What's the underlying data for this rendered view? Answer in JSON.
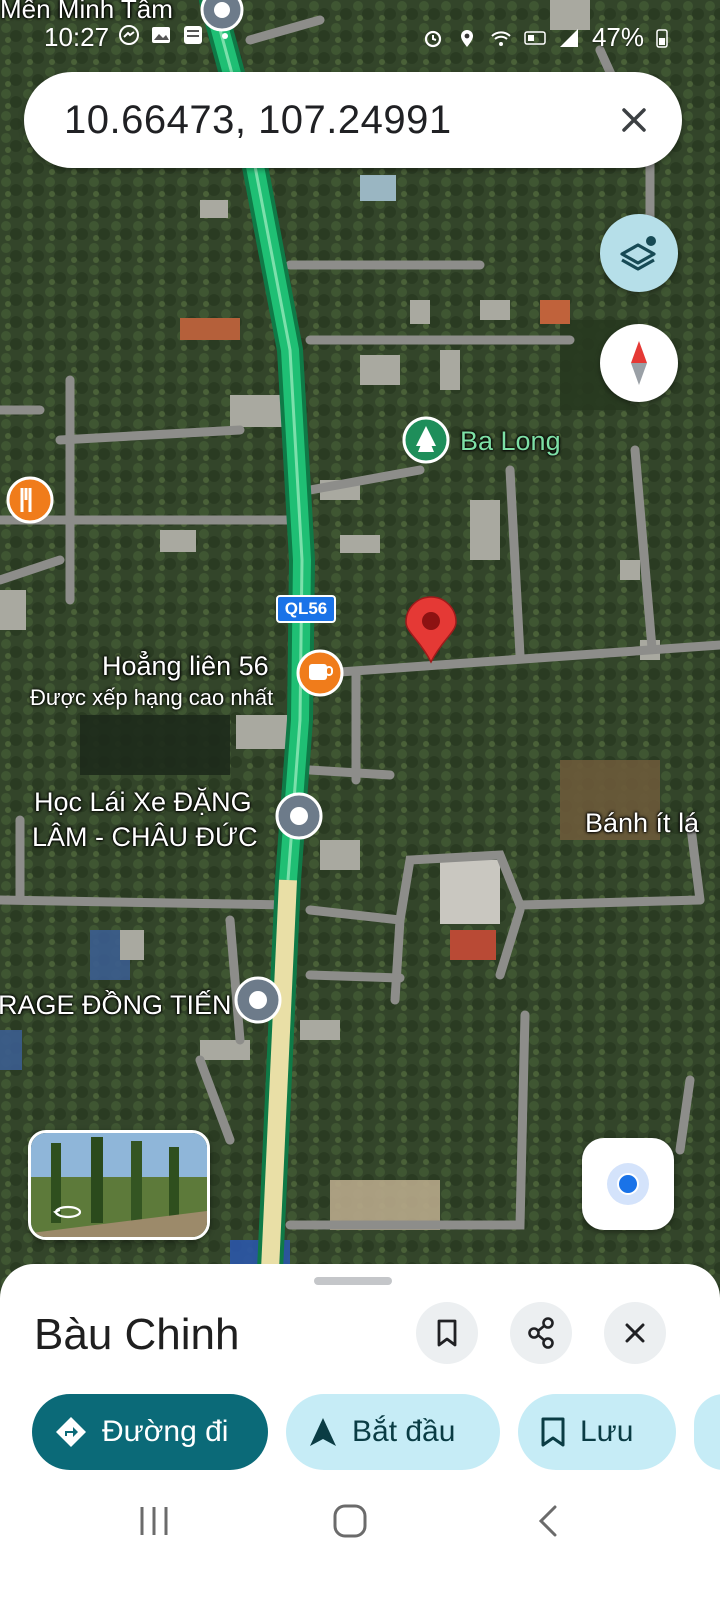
{
  "status_bar": {
    "time": "10:27",
    "battery": "47%",
    "left_icons": [
      "messenger-icon",
      "gallery-icon",
      "baomoi-icon",
      "dot-icon"
    ],
    "right_icons": [
      "alarm-icon",
      "location-icon",
      "wifi-icon",
      "volte-icon",
      "signal-icon",
      "battery-icon"
    ]
  },
  "search": {
    "query": "10.66473, 107.24991"
  },
  "map": {
    "partial_top_label": "Mến Minh Tâm",
    "route_shield": "QL56",
    "pois": {
      "ba_long": "Ba Long",
      "hoang_lien": "Hoẳng liên 56",
      "hoang_lien_sub": "Được xếp hạng cao nhất",
      "hoc_lai_xe_line1": "Học Lái Xe ĐẶNG",
      "hoc_lai_xe_line2": "LÂM - CHÂU ĐỨC",
      "garage": "RAGE ĐỒNG TIẾN",
      "banh_it": "Bánh ít lá"
    },
    "colors": {
      "highway": "#1fbf74",
      "poi_green": "#1e8e5a",
      "poi_orange": "#f07c1b",
      "pin_red": "#e53935"
    }
  },
  "place": {
    "title": "Bàu Chinh"
  },
  "actions": {
    "directions": "Đường đi",
    "start": "Bắt đầu",
    "save": "Lưu"
  },
  "nav": {
    "items": [
      "recents-icon",
      "home-icon",
      "back-icon"
    ]
  }
}
